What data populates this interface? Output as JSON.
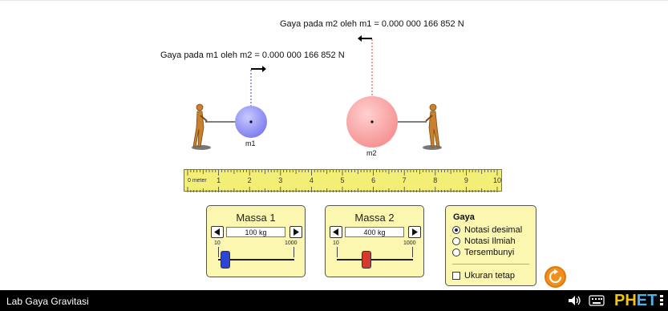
{
  "force_labels": {
    "m1": "Gaya pada m1 oleh m2 = 0.000 000 166 852 N",
    "m2": "Gaya pada m2 oleh m1 = 0.000 000 166 852 N"
  },
  "masses": {
    "m1": {
      "label": "m1",
      "color": "#8b8bf0"
    },
    "m2": {
      "label": "m2",
      "color": "#f7a0a0"
    }
  },
  "ruler": {
    "unit_label": "0 meter",
    "tick_labels": [
      "1",
      "2",
      "3",
      "4",
      "5",
      "6",
      "7",
      "8",
      "9",
      "10"
    ]
  },
  "mass_panels": [
    {
      "title": "Massa 1",
      "value": "100 kg",
      "min_label": "10",
      "max_label": "1000",
      "value_fraction": 0.09,
      "thumb_color": "#2d45d9"
    },
    {
      "title": "Massa 2",
      "value": "400 kg",
      "min_label": "10",
      "max_label": "1000",
      "value_fraction": 0.39,
      "thumb_color": "#d63a2f"
    }
  ],
  "force_panel": {
    "title": "Gaya",
    "options": [
      "Notasi desimal",
      "Notasi Ilmiah",
      "Tersembunyi"
    ],
    "selected": "Notasi desimal",
    "constant_size_label": "Ukuran tetap",
    "constant_size_checked": false
  },
  "nav": {
    "title": "Lab Gaya Gravitasi",
    "logo_ph": "PH",
    "logo_et": "ET"
  },
  "icons": {
    "sound": "speaker-icon",
    "keyboard": "keyboard-icon",
    "reset": "reset-icon",
    "menu": "menu-icon"
  }
}
